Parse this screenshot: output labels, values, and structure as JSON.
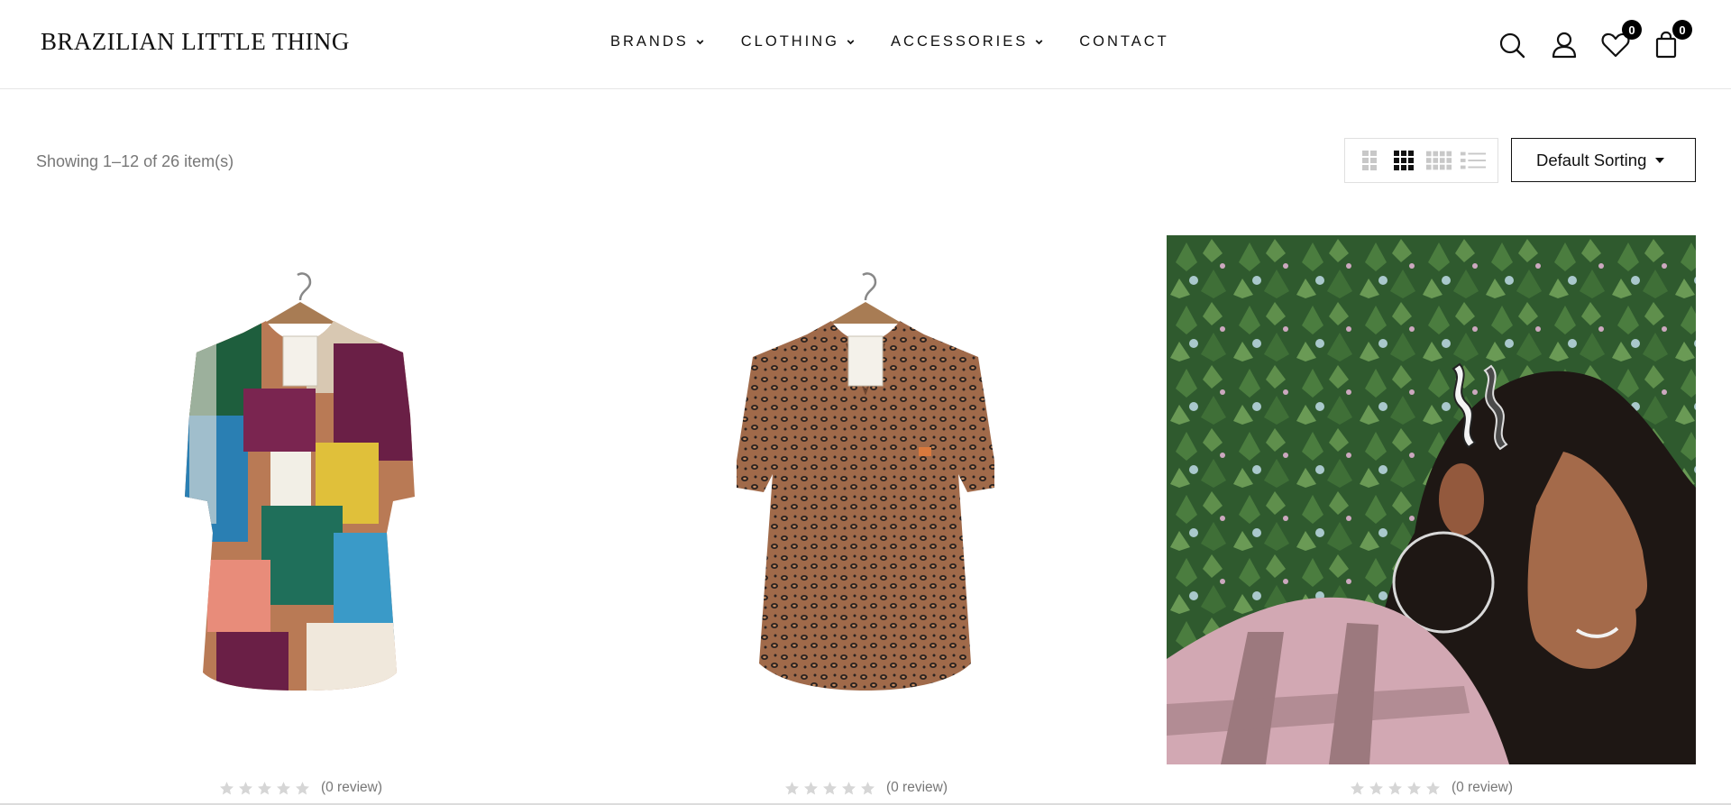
{
  "header": {
    "logo": "BRAZILIAN LITTLE THING",
    "nav": [
      {
        "label": "BRANDS",
        "has_dropdown": true
      },
      {
        "label": "CLOTHING",
        "has_dropdown": true
      },
      {
        "label": "ACCESSORIES",
        "has_dropdown": true
      },
      {
        "label": "CONTACT",
        "has_dropdown": false
      }
    ],
    "icons": {
      "search": "search-icon",
      "account": "user-icon",
      "wishlist": "heart-icon",
      "cart": "shopping-bag-icon"
    },
    "wishlist_count": "0",
    "cart_count": "0"
  },
  "toolbar": {
    "result_count": "Showing 1–12 of 26 item(s)",
    "view_modes": [
      "grid-2",
      "grid-3",
      "grid-4",
      "list"
    ],
    "active_view": "grid-3",
    "sort_label": "Default Sorting"
  },
  "products": [
    {
      "image": "multicolor abstract print short-sleeve shirt on hanger",
      "rating": 0,
      "review_text": "(0 review)"
    },
    {
      "image": "leopard print short-sleeve shirt on hanger",
      "rating": 0,
      "review_text": "(0 review)"
    },
    {
      "image": "woman wearing wavy hair clips, ivy wall background",
      "rating": 0,
      "review_text": "(0 review)"
    }
  ],
  "colors": {
    "text": "#111111",
    "muted": "#777777",
    "star_empty": "#d6d6d6",
    "badge": "#000000"
  }
}
